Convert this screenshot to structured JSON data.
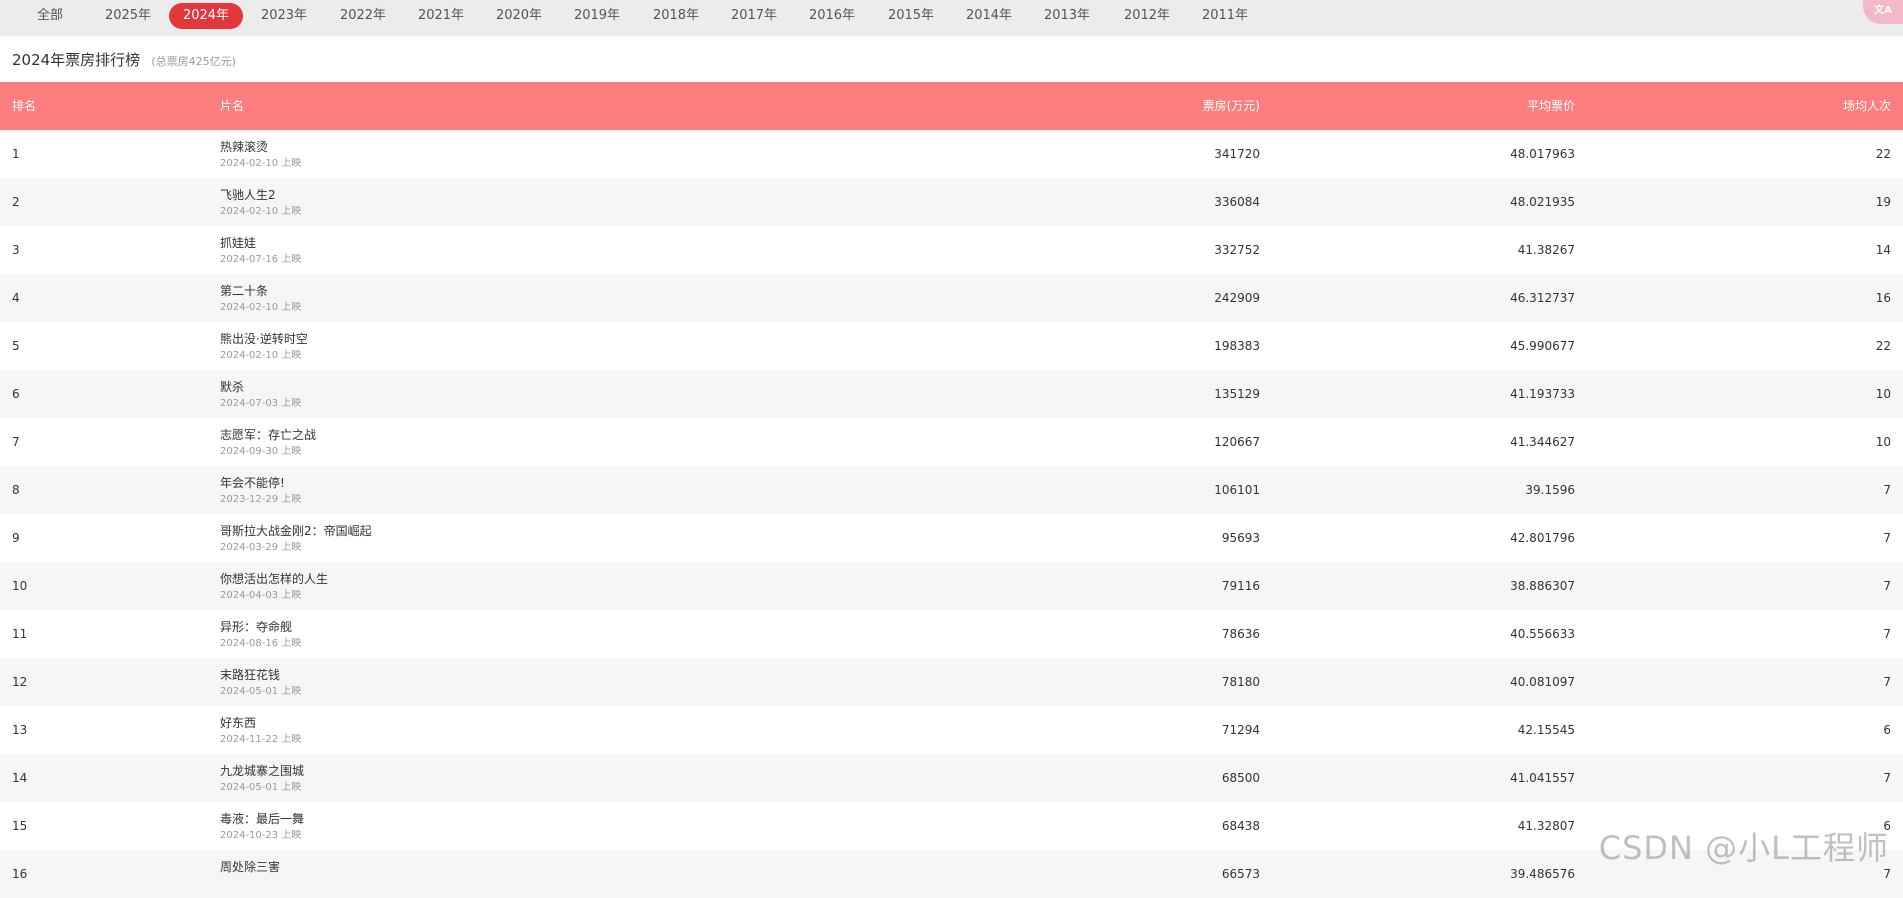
{
  "year_tabs": [
    {
      "label": "全部",
      "active": false
    },
    {
      "label": "2025年",
      "active": false
    },
    {
      "label": "2024年",
      "active": true
    },
    {
      "label": "2023年",
      "active": false
    },
    {
      "label": "2022年",
      "active": false
    },
    {
      "label": "2021年",
      "active": false
    },
    {
      "label": "2020年",
      "active": false
    },
    {
      "label": "2019年",
      "active": false
    },
    {
      "label": "2018年",
      "active": false
    },
    {
      "label": "2017年",
      "active": false
    },
    {
      "label": "2016年",
      "active": false
    },
    {
      "label": "2015年",
      "active": false
    },
    {
      "label": "2014年",
      "active": false
    },
    {
      "label": "2013年",
      "active": false
    },
    {
      "label": "2012年",
      "active": false
    },
    {
      "label": "2011年",
      "active": false
    }
  ],
  "translate_button": {
    "label": "文A",
    "icon": "translate-icon"
  },
  "page": {
    "title": "2024年票房排行榜",
    "subtitle": "(总票房425亿元)"
  },
  "table": {
    "headers": {
      "rank": "排名",
      "name": "片名",
      "box_office": "票房(万元)",
      "avg_price": "平均票价",
      "avg_attendance": "场均人次"
    },
    "rows": [
      {
        "rank": "1",
        "name": "热辣滚烫",
        "date": "2024-02-10 上映",
        "box_office": "341720",
        "avg_price": "48.017963",
        "avg_attendance": "22"
      },
      {
        "rank": "2",
        "name": "飞驰人生2",
        "date": "2024-02-10 上映",
        "box_office": "336084",
        "avg_price": "48.021935",
        "avg_attendance": "19"
      },
      {
        "rank": "3",
        "name": "抓娃娃",
        "date": "2024-07-16 上映",
        "box_office": "332752",
        "avg_price": "41.38267",
        "avg_attendance": "14"
      },
      {
        "rank": "4",
        "name": "第二十条",
        "date": "2024-02-10 上映",
        "box_office": "242909",
        "avg_price": "46.312737",
        "avg_attendance": "16"
      },
      {
        "rank": "5",
        "name": "熊出没·逆转时空",
        "date": "2024-02-10 上映",
        "box_office": "198383",
        "avg_price": "45.990677",
        "avg_attendance": "22"
      },
      {
        "rank": "6",
        "name": "默杀",
        "date": "2024-07-03 上映",
        "box_office": "135129",
        "avg_price": "41.193733",
        "avg_attendance": "10"
      },
      {
        "rank": "7",
        "name": "志愿军：存亡之战",
        "date": "2024-09-30 上映",
        "box_office": "120667",
        "avg_price": "41.344627",
        "avg_attendance": "10"
      },
      {
        "rank": "8",
        "name": "年会不能停!",
        "date": "2023-12-29 上映",
        "box_office": "106101",
        "avg_price": "39.1596",
        "avg_attendance": "7"
      },
      {
        "rank": "9",
        "name": "哥斯拉大战金刚2：帝国崛起",
        "date": "2024-03-29 上映",
        "box_office": "95693",
        "avg_price": "42.801796",
        "avg_attendance": "7"
      },
      {
        "rank": "10",
        "name": "你想活出怎样的人生",
        "date": "2024-04-03 上映",
        "box_office": "79116",
        "avg_price": "38.886307",
        "avg_attendance": "7"
      },
      {
        "rank": "11",
        "name": "异形：夺命舰",
        "date": "2024-08-16 上映",
        "box_office": "78636",
        "avg_price": "40.556633",
        "avg_attendance": "7"
      },
      {
        "rank": "12",
        "name": "末路狂花钱",
        "date": "2024-05-01 上映",
        "box_office": "78180",
        "avg_price": "40.081097",
        "avg_attendance": "7"
      },
      {
        "rank": "13",
        "name": "好东西",
        "date": "2024-11-22 上映",
        "box_office": "71294",
        "avg_price": "42.15545",
        "avg_attendance": "6"
      },
      {
        "rank": "14",
        "name": "九龙城寨之围城",
        "date": "2024-05-01 上映",
        "box_office": "68500",
        "avg_price": "41.041557",
        "avg_attendance": "7"
      },
      {
        "rank": "15",
        "name": "毒液：最后一舞",
        "date": "2024-10-23 上映",
        "box_office": "68438",
        "avg_price": "41.32807",
        "avg_attendance": "6"
      },
      {
        "rank": "16",
        "name": "周处除三害",
        "date": "",
        "box_office": "66573",
        "avg_price": "39.486576",
        "avg_attendance": "7"
      }
    ]
  },
  "watermark": "CSDN @小L工程师"
}
